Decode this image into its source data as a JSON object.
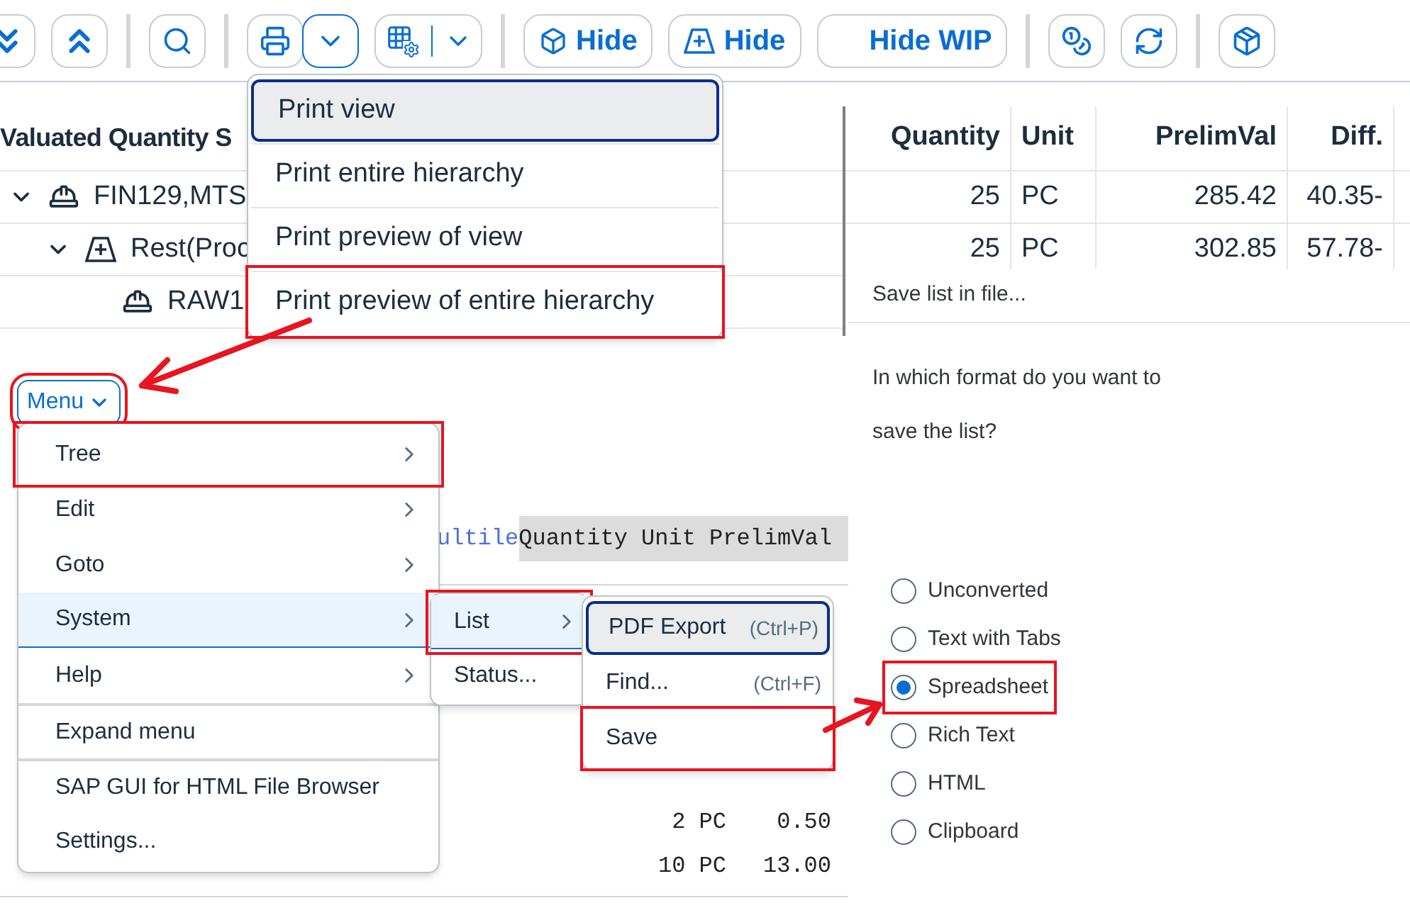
{
  "toolbar": [
    {
      "kind": "icon",
      "selected": false
    },
    {
      "kind": "icon",
      "selected": false
    },
    {
      "kind": "icon",
      "selected": false
    },
    {
      "kind": "icon",
      "selected": false
    },
    {
      "kind": "dropdown",
      "selected": true
    },
    {
      "kind": "split",
      "selected": false
    },
    {
      "kind": "text",
      "label": "Hide",
      "selected": false
    },
    {
      "kind": "text",
      "label": "Hide",
      "selected": false
    },
    {
      "kind": "text",
      "label": "Hide WIP",
      "selected": false
    },
    {
      "kind": "icon",
      "selected": false
    },
    {
      "kind": "icon",
      "selected": false
    },
    {
      "kind": "icon",
      "selected": false
    }
  ],
  "tree": {
    "header": "Valuated Quantity S",
    "rows": [
      {
        "label": "FIN129,MTS",
        "expanded": true,
        "children": [
          {
            "label": "Rest(Proc",
            "expanded": true,
            "children": [
              {
                "label": "RAW1"
              }
            ]
          }
        ]
      }
    ]
  },
  "table": {
    "columns": [
      "Quantity",
      "Unit",
      "PrelimVal",
      "Diff."
    ],
    "rows": [
      [
        "25",
        "PC",
        "285.42",
        "40.35-"
      ],
      [
        "25",
        "PC",
        "302.85",
        "57.78-"
      ]
    ]
  },
  "print_menu": [
    {
      "label": "Print view",
      "selected": true,
      "annotated": false
    },
    {
      "label": "Print entire hierarchy",
      "selected": false,
      "annotated": false
    },
    {
      "label": "Print preview of view",
      "selected": false,
      "annotated": false
    },
    {
      "label": "Print preview of entire hierarchy",
      "selected": false,
      "annotated": true
    }
  ],
  "menu_button": {
    "label": "Menu",
    "annotated": true
  },
  "menu": [
    {
      "label": "Tree",
      "submenu": true,
      "selected": false,
      "annotated": true,
      "separator_before": false
    },
    {
      "label": "Edit",
      "submenu": true,
      "selected": false,
      "annotated": false,
      "separator_before": false
    },
    {
      "label": "Goto",
      "submenu": true,
      "selected": false,
      "annotated": false,
      "separator_before": false
    },
    {
      "label": "System",
      "submenu": true,
      "selected": true,
      "annotated": false,
      "separator_before": false
    },
    {
      "label": "Help",
      "submenu": true,
      "selected": false,
      "annotated": false,
      "separator_before": false
    },
    {
      "label": "Expand menu",
      "submenu": false,
      "selected": false,
      "annotated": false,
      "separator_before": true
    },
    {
      "label": "SAP GUI for HTML File Browser",
      "submenu": false,
      "selected": false,
      "annotated": false,
      "separator_before": true
    },
    {
      "label": "Settings...",
      "submenu": false,
      "selected": false,
      "annotated": false,
      "separator_before": false
    }
  ],
  "system_submenu": [
    {
      "label": "List",
      "submenu": true,
      "selected": true,
      "annotated": true
    },
    {
      "label": "Status...",
      "submenu": false,
      "selected": false,
      "annotated": false
    }
  ],
  "list_submenu": [
    {
      "label": "PDF Export",
      "shortcut": "(Ctrl+P)",
      "selected": true,
      "annotated": false
    },
    {
      "label": "Find...",
      "shortcut": "(Ctrl+F)",
      "selected": false,
      "annotated": false
    },
    {
      "label": "Save",
      "selected": false,
      "annotated": true
    }
  ],
  "background_list": {
    "code_prefix": "ultile",
    "code_text": "Quantity Unit PrelimVal",
    "rows": [
      [
        "2 PC",
        "0.50"
      ],
      [
        "10 PC",
        "13.00"
      ]
    ]
  },
  "save_dialog": {
    "title": "Save list in file...",
    "question": "In which format do you want to save the list?",
    "options": [
      {
        "label": "Unconverted",
        "selected": false,
        "annotated": false
      },
      {
        "label": "Text with Tabs",
        "selected": false,
        "annotated": false
      },
      {
        "label": "Spreadsheet",
        "selected": true,
        "annotated": true
      },
      {
        "label": "Rich Text",
        "selected": false,
        "annotated": false
      },
      {
        "label": "HTML",
        "selected": false,
        "annotated": false
      },
      {
        "label": "Clipboard",
        "selected": false,
        "annotated": false
      }
    ]
  }
}
